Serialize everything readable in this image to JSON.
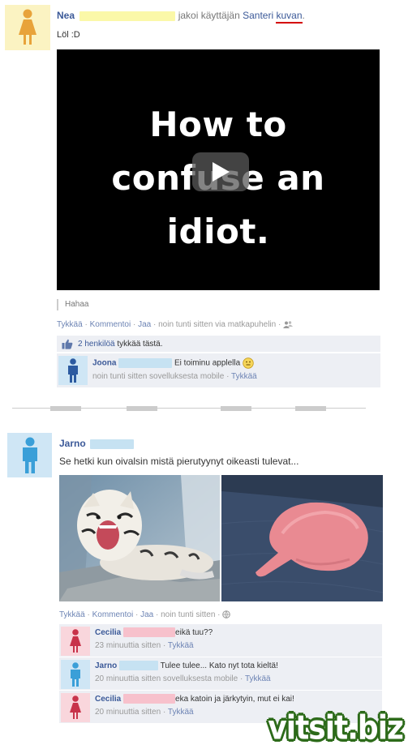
{
  "post1": {
    "author": "Nea",
    "verb": "jakoi käyttäjän",
    "target_user": "Santeri",
    "target_object": "kuvan",
    "period": ".",
    "text": "Löl :D",
    "video": {
      "line1": "How to",
      "line2": "confuse an",
      "line3": "idiot."
    },
    "caption": "Hahaa",
    "actions": {
      "like": "Tykkää",
      "comment": "Kommentoi",
      "share": "Jaa",
      "meta": "noin tunti sitten via matkapuhelin"
    },
    "likes": {
      "count_link": "2 henkilöä",
      "suffix": "tykkää tästä."
    },
    "comments": [
      {
        "author": "Joona",
        "text": "Ei toiminu applella",
        "meta": "noin tunti sitten sovelluksesta mobile",
        "like": "Tykkää"
      }
    ]
  },
  "post2": {
    "author": "Jarno",
    "text": "Se hetki kun oivalsin mistä pierutyynyt oikeasti tulevat...",
    "actions": {
      "like": "Tykkää",
      "comment": "Kommentoi",
      "share": "Jaa",
      "meta": "noin tunti sitten"
    },
    "comments": [
      {
        "author": "Cecilia",
        "text": "eikä tuu??",
        "meta": "23 minuuttia sitten",
        "like": "Tykkää"
      },
      {
        "author": "Jarno",
        "text": "Tulee tulee... Kato nyt tota kieltä!",
        "meta": "20 minuuttia sitten sovelluksesta mobile",
        "like": "Tykkää"
      },
      {
        "author": "Cecilia",
        "text": "eka katoin ja järkytyin, mut ei kai!",
        "meta": "20 minuuttia sitten",
        "like": "Tykkää"
      }
    ]
  },
  "watermark": "vitsit.biz",
  "colors": {
    "link": "#3b5998",
    "ufi_bg": "#edeff4",
    "watermark_outline": "#2d6b1a"
  }
}
